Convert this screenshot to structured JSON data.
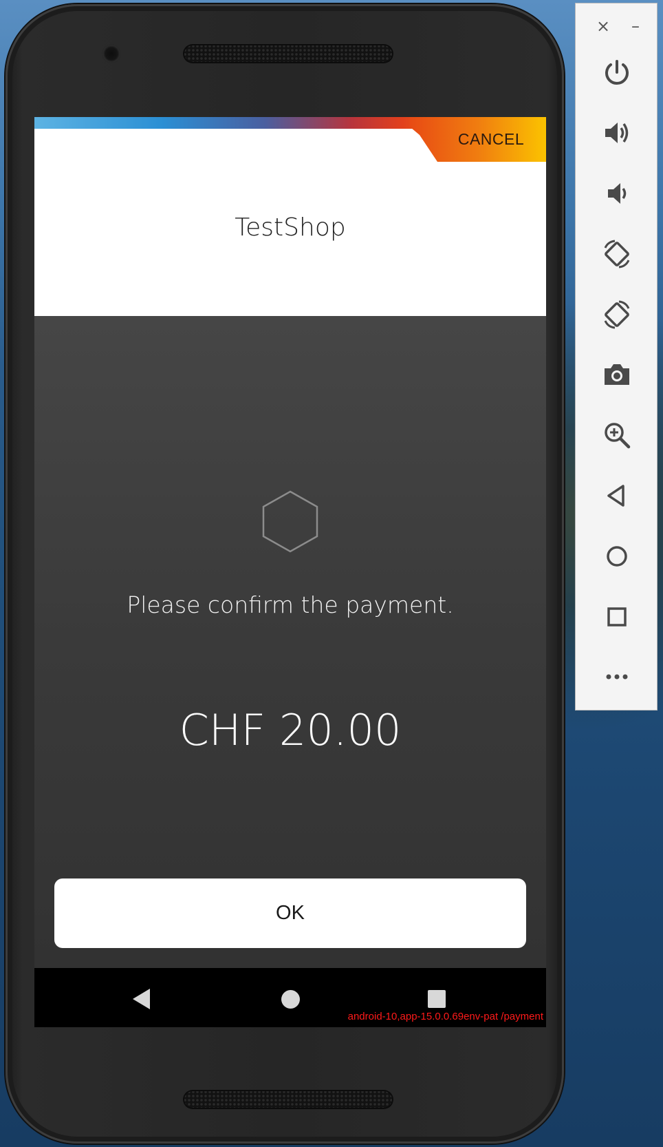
{
  "app": {
    "shop_name": "TestShop",
    "cancel_label": "CANCEL",
    "message": "Please confirm the payment.",
    "amount": "CHF 20.00",
    "ok_label": "OK",
    "debug_label": "android-10,app-15.0.0.69env-pat /payment"
  },
  "colors": {
    "accent_gradient": [
      "#5db3e3",
      "#2b8fd4",
      "#b8343c",
      "#e2401c",
      "#fbc700"
    ],
    "content_bg": "#3a3a3a",
    "debug_text": "#ff1a1a"
  },
  "android_nav": {
    "back": "back-triangle-icon",
    "home": "home-circle-icon",
    "recents": "recents-square-icon"
  },
  "emulator_toolbar": {
    "close": "×",
    "minimize": "–",
    "buttons": [
      "power-icon",
      "volume-up-icon",
      "volume-down-icon",
      "rotate-left-icon",
      "rotate-right-icon",
      "camera-icon",
      "zoom-icon",
      "back-icon",
      "home-icon",
      "overview-icon",
      "more-icon"
    ]
  }
}
